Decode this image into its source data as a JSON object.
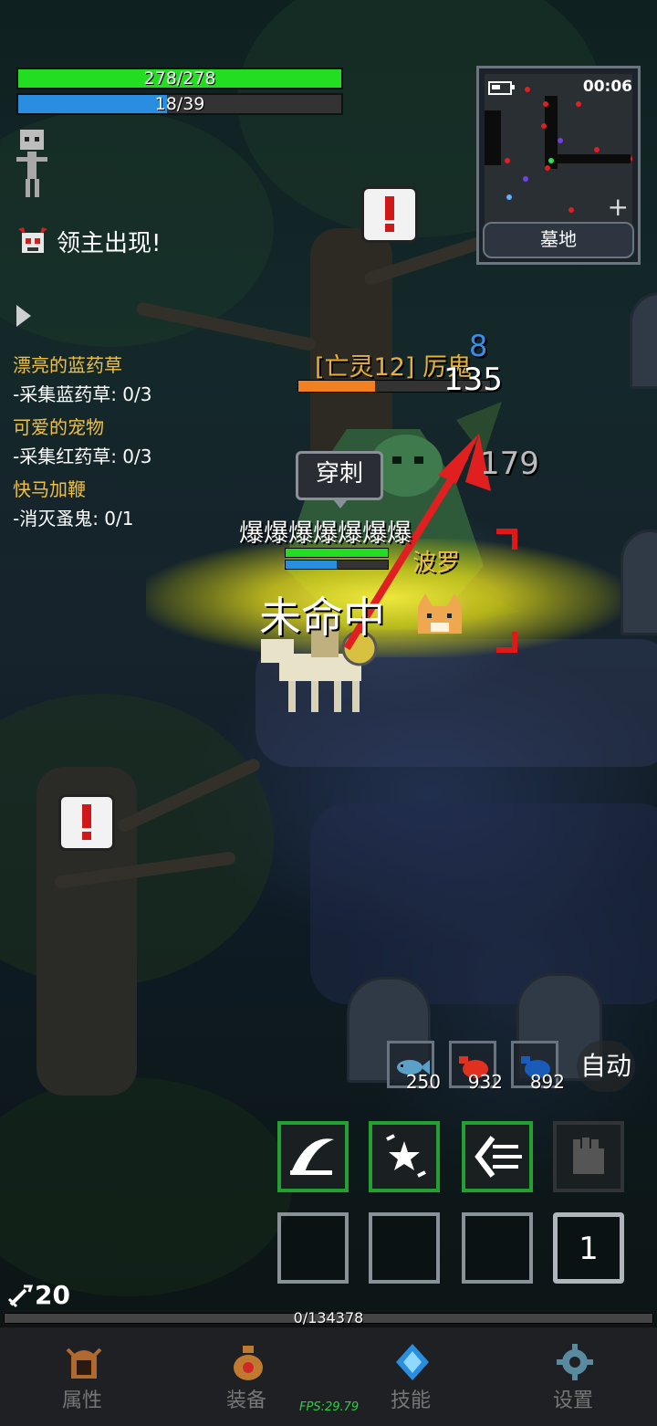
{
  "hud": {
    "hp_text": "278/278",
    "hp_fraction": 1.0,
    "mp_text": "18/39",
    "mp_fraction": 0.46
  },
  "minimap": {
    "time": "00:06",
    "location": "墓地"
  },
  "quest_log": {
    "boss_alert": "领主出现!",
    "quests": [
      {
        "title": "漂亮的蓝药草",
        "task": "-采集蓝药草: 0/3"
      },
      {
        "title": "可爱的宠物",
        "task": "-采集红药草: 0/3"
      },
      {
        "title": "快马加鞭",
        "task": "-消灭蚤鬼: 0/1"
      }
    ]
  },
  "battle": {
    "boss_name": "[亡灵12] 厉鬼",
    "boss_hp_fraction": 0.4,
    "damage_blue": "8",
    "damage_white": "135",
    "damage_grey": "179",
    "skill_name": "穿刺",
    "burst_text": "爆爆爆爆爆爆爆",
    "pet_name": "波罗",
    "miss_text": "未命中"
  },
  "potions": [
    {
      "icon": "fish-icon",
      "count": "250"
    },
    {
      "icon": "red-potion-icon",
      "count": "932"
    },
    {
      "icon": "blue-potion-icon",
      "count": "892"
    }
  ],
  "auto_label": "自动",
  "skill_page": "1",
  "weapon_level": "20",
  "exp_text": "0/134378",
  "nav": {
    "attributes": "属性",
    "equipment": "装备",
    "skills": "技能",
    "settings": "设置"
  },
  "fps_text": "FPS:29.79",
  "colors": {
    "hp": "#22dd22",
    "mp": "#2a8ee0",
    "quest_title": "#f0c040",
    "skill_active_border": "#22a032"
  }
}
